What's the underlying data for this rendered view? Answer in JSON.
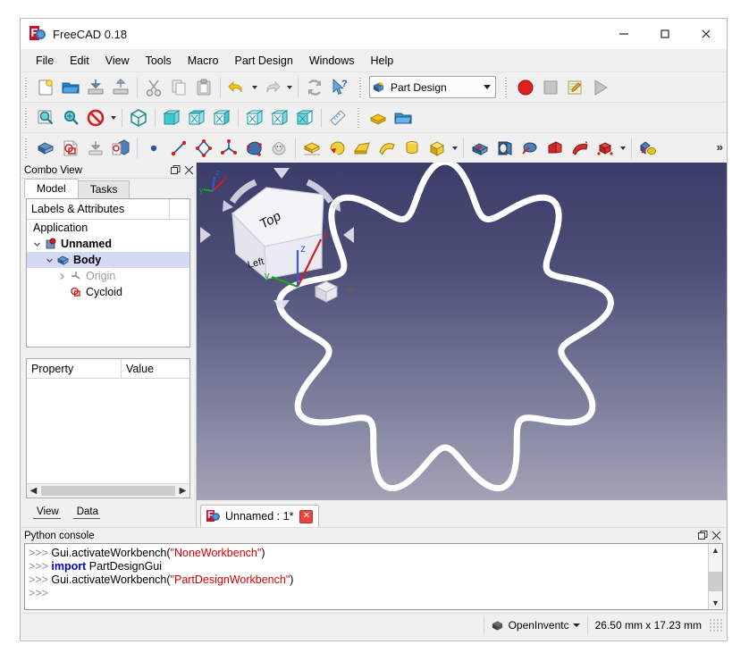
{
  "window": {
    "title": "FreeCAD 0.18",
    "app_icon": "freecad-icon",
    "minimize": "—",
    "maximize": "□",
    "close": "✕"
  },
  "menubar": {
    "items": [
      {
        "label": "File"
      },
      {
        "label": "Edit"
      },
      {
        "label": "View"
      },
      {
        "label": "Tools"
      },
      {
        "label": "Macro"
      },
      {
        "label": "Part Design"
      },
      {
        "label": "Windows"
      },
      {
        "label": "Help"
      }
    ]
  },
  "toolbars": {
    "row1": [
      {
        "name": "new-document-button",
        "icon": "new-document-icon"
      },
      {
        "name": "open-document-button",
        "icon": "open-folder-icon"
      },
      {
        "name": "save-document-button",
        "icon": "save-icon"
      },
      {
        "name": "save-as-button",
        "icon": "save-as-icon"
      },
      {
        "name": "cut-button",
        "icon": "scissors-icon"
      },
      {
        "name": "copy-button",
        "icon": "copy-icon"
      },
      {
        "name": "paste-button",
        "icon": "clipboard-icon"
      },
      {
        "name": "undo-button",
        "icon": "undo-arrow-icon"
      },
      {
        "name": "redo-button",
        "icon": "redo-arrow-icon"
      },
      {
        "name": "refresh-button",
        "icon": "refresh-icon"
      },
      {
        "name": "whats-this-button",
        "icon": "cursor-question-icon"
      }
    ],
    "workbench_selector": {
      "label": "Part Design",
      "icon": "part-design-icon"
    },
    "macro": [
      {
        "name": "macro-record-button",
        "icon": "record-circle-icon"
      },
      {
        "name": "macro-stop-button",
        "icon": "stop-square-icon"
      },
      {
        "name": "macro-edit-button",
        "icon": "notepad-pencil-icon"
      },
      {
        "name": "macro-execute-button",
        "icon": "play-triangle-icon"
      }
    ],
    "row2": [
      {
        "name": "fit-all-button",
        "icon": "fit-all-icon"
      },
      {
        "name": "fit-selection-button",
        "icon": "fit-selection-icon"
      },
      {
        "name": "draw-style-button",
        "icon": "no-entry-icon"
      },
      {
        "name": "isometric-view-button",
        "icon": "axonometric-cube-icon"
      },
      {
        "name": "front-view-button",
        "icon": "front-view-cube-icon"
      },
      {
        "name": "top-view-button",
        "icon": "top-view-cube-icon"
      },
      {
        "name": "right-view-button",
        "icon": "right-view-cube-icon"
      },
      {
        "name": "rear-view-button",
        "icon": "rear-view-cube-icon"
      },
      {
        "name": "bottom-view-button",
        "icon": "bottom-view-cube-icon"
      },
      {
        "name": "left-view-button",
        "icon": "left-view-cube-icon"
      },
      {
        "name": "measure-button",
        "icon": "ruler-icon"
      },
      {
        "name": "workbench-extra-1-button",
        "icon": "yellow-stack-icon"
      },
      {
        "name": "workbench-extra-2-button",
        "icon": "folder-icon"
      }
    ],
    "row3": [
      {
        "name": "create-body-button",
        "icon": "blue-body-icon"
      },
      {
        "name": "create-sketch-button",
        "icon": "create-sketch-icon"
      },
      {
        "name": "attach-sketch-button",
        "icon": "attach-sketch-icon"
      },
      {
        "name": "map-sketch-button",
        "icon": "map-sketch-icon"
      },
      {
        "name": "create-point-button",
        "icon": "point-icon"
      },
      {
        "name": "create-line-button",
        "icon": "line-icon"
      },
      {
        "name": "create-polyline-button",
        "icon": "polyline-icon"
      },
      {
        "name": "create-plane-button",
        "icon": "datum-plane-icon"
      },
      {
        "name": "create-shapebinder-button",
        "icon": "shape-binder-icon"
      },
      {
        "name": "clone-button",
        "icon": "sheep-clone-icon"
      },
      {
        "name": "pad-button",
        "icon": "pad-icon"
      },
      {
        "name": "revolution-button",
        "icon": "revolution-icon"
      },
      {
        "name": "loft-button",
        "icon": "additive-loft-icon"
      },
      {
        "name": "pipe-button",
        "icon": "additive-pipe-icon"
      },
      {
        "name": "helix-button",
        "icon": "additive-helix-icon"
      },
      {
        "name": "primitive-button",
        "icon": "additive-box-icon"
      },
      {
        "name": "pocket-button",
        "icon": "pocket-icon"
      },
      {
        "name": "hole-button",
        "icon": "hole-icon"
      },
      {
        "name": "groove-button",
        "icon": "groove-icon"
      },
      {
        "name": "subtractive-loft-button",
        "icon": "subtractive-loft-icon"
      },
      {
        "name": "subtractive-pipe-button",
        "icon": "subtractive-pipe-icon"
      },
      {
        "name": "subtractive-primitive-button",
        "icon": "subtractive-box-icon"
      },
      {
        "name": "boolean-button",
        "icon": "boolean-icon"
      }
    ],
    "overflow_label": "»"
  },
  "combo_view": {
    "title": "Combo View",
    "float_icon": "float-panel-icon",
    "close_icon": "close-panel-icon",
    "tabs": [
      {
        "label": "Model",
        "active": true
      },
      {
        "label": "Tasks",
        "active": false
      }
    ],
    "tree_header": "Labels & Attributes",
    "tree": [
      {
        "label": "Application",
        "indent": 0,
        "bold": false,
        "dim": false,
        "arrow": "",
        "icon": "",
        "selected": false
      },
      {
        "label": "Unnamed",
        "indent": 1,
        "bold": true,
        "dim": false,
        "arrow": "down",
        "icon": "document-icon",
        "selected": false
      },
      {
        "label": "Body",
        "indent": 2,
        "bold": true,
        "dim": false,
        "arrow": "down",
        "icon": "body-icon",
        "selected": true
      },
      {
        "label": "Origin",
        "indent": 3,
        "bold": false,
        "dim": true,
        "arrow": "right",
        "icon": "origin-icon",
        "selected": false
      },
      {
        "label": "Cycloid",
        "indent": 3,
        "bold": false,
        "dim": false,
        "arrow": "",
        "icon": "sketch-icon",
        "selected": false
      }
    ],
    "property_header": {
      "property": "Property",
      "value": "Value"
    },
    "bottom_tabs": [
      {
        "label": "View",
        "active": false
      },
      {
        "label": "Data",
        "active": true
      }
    ]
  },
  "view3d": {
    "document_tab": {
      "label": "Unnamed : 1*",
      "icon": "freecad-icon",
      "close_icon": "close-tab-icon"
    },
    "navigation_cube": {
      "top_face_label": "Top",
      "left_face_label": "Left",
      "axis_x": "x",
      "axis_y": "y",
      "axis_z": "z"
    },
    "axis_cross": {
      "x": "x",
      "y": "y",
      "z": "z"
    },
    "background_top": "#3b3d69",
    "background_bottom": "#a3a3b6",
    "geometry_name": "cycloid-curve",
    "geometry_color": "#ffffff",
    "geometry_lobes": 9
  },
  "python_console": {
    "title": "Python console",
    "float_icon": "float-panel-icon",
    "close_icon": "close-panel-icon",
    "lines": [
      {
        "prompt": ">>> ",
        "tokens": [
          {
            "t": "Gui.activateWorkbench(",
            "c": "pn"
          },
          {
            "t": "\"NoneWorkbench\"",
            "c": "str"
          },
          {
            "t": ")",
            "c": "pn"
          }
        ]
      },
      {
        "prompt": ">>> ",
        "tokens": [
          {
            "t": "import",
            "c": "kw"
          },
          {
            "t": " PartDesignGui",
            "c": "pn"
          }
        ]
      },
      {
        "prompt": ">>> ",
        "tokens": [
          {
            "t": "Gui.activateWorkbench(",
            "c": "pn"
          },
          {
            "t": "\"PartDesignWorkbench\"",
            "c": "str"
          },
          {
            "t": ")",
            "c": "pn"
          }
        ]
      },
      {
        "prompt": ">>> ",
        "tokens": []
      }
    ]
  },
  "status_bar": {
    "renderer": {
      "label": "OpenInventc",
      "icon": "cube-icon"
    },
    "dimensions": "26.50 mm x 17.23 mm",
    "resize_grip": "resize-grip-icon"
  }
}
